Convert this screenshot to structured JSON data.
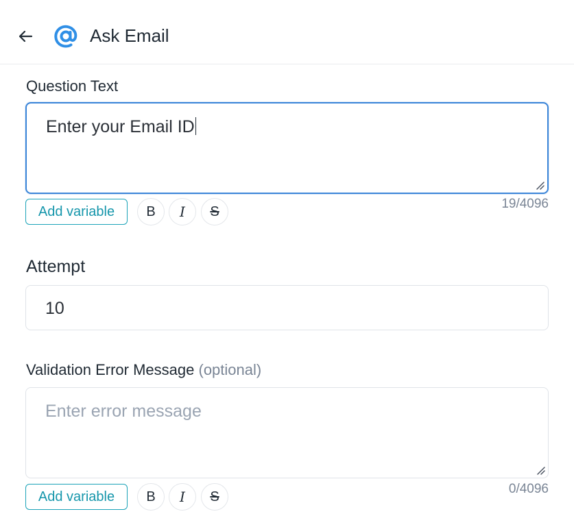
{
  "header": {
    "title": "Ask Email",
    "back_icon": "arrow-left-icon",
    "type_icon": "at-sign-icon",
    "accent": "#2f8fe6"
  },
  "question": {
    "label": "Question Text",
    "value": "Enter your Email ID",
    "counter": "19/4096",
    "add_variable_label": "Add variable",
    "bold_label": "B",
    "italic_label": "I",
    "strike_label": "S"
  },
  "attempt": {
    "label": "Attempt",
    "value": "10"
  },
  "validation": {
    "label": "Validation Error Message",
    "optional": "(optional)",
    "placeholder": "Enter error message",
    "counter": "0/4096",
    "add_variable_label": "Add variable",
    "bold_label": "B",
    "italic_label": "I",
    "strike_label": "S"
  },
  "colors": {
    "focus_border": "#3a84d8",
    "add_variable": "#1596ab",
    "muted_text": "#7a8595"
  }
}
